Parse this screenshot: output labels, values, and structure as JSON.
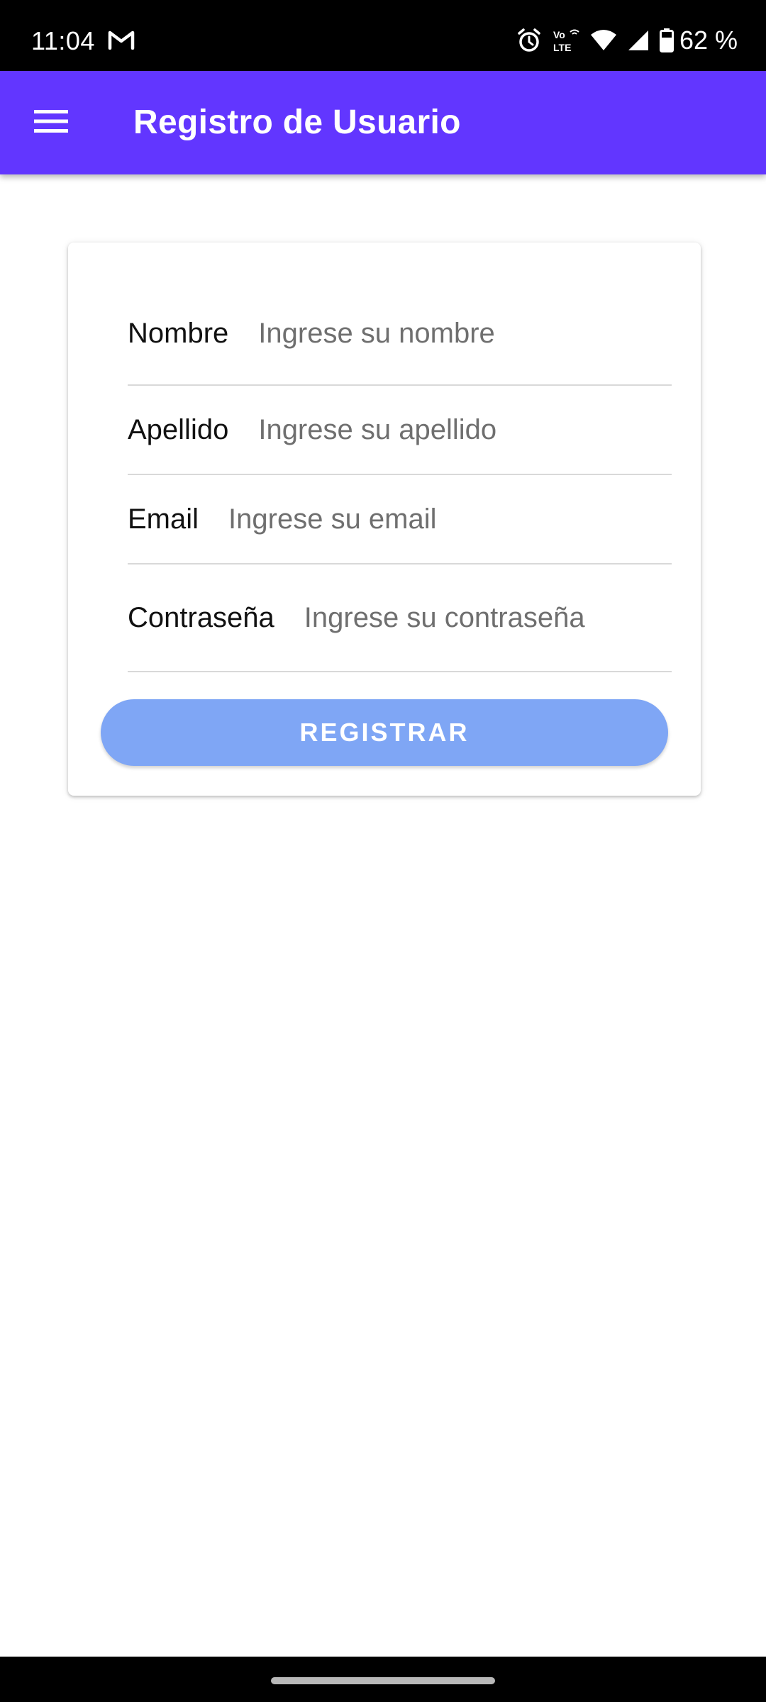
{
  "status_bar": {
    "time": "11:04",
    "battery_percent": "62 %",
    "icons": [
      "gmail-icon",
      "alarm-icon",
      "volte-icon",
      "wifi-icon",
      "signal-icon",
      "battery-icon"
    ]
  },
  "app_bar": {
    "title": "Registro de Usuario",
    "menu_icon": "menu-icon",
    "background_color": "#6236ff"
  },
  "form": {
    "fields": [
      {
        "label": "Nombre",
        "placeholder": "Ingrese su nombre",
        "value": ""
      },
      {
        "label": "Apellido",
        "placeholder": "Ingrese su apellido",
        "value": ""
      },
      {
        "label": "Email",
        "placeholder": "Ingrese su email",
        "value": ""
      },
      {
        "label": "Contraseña",
        "placeholder": "Ingrese su contraseña",
        "value": ""
      }
    ],
    "submit_label": "REGISTRAR",
    "submit_color": "#7fa6f5"
  }
}
